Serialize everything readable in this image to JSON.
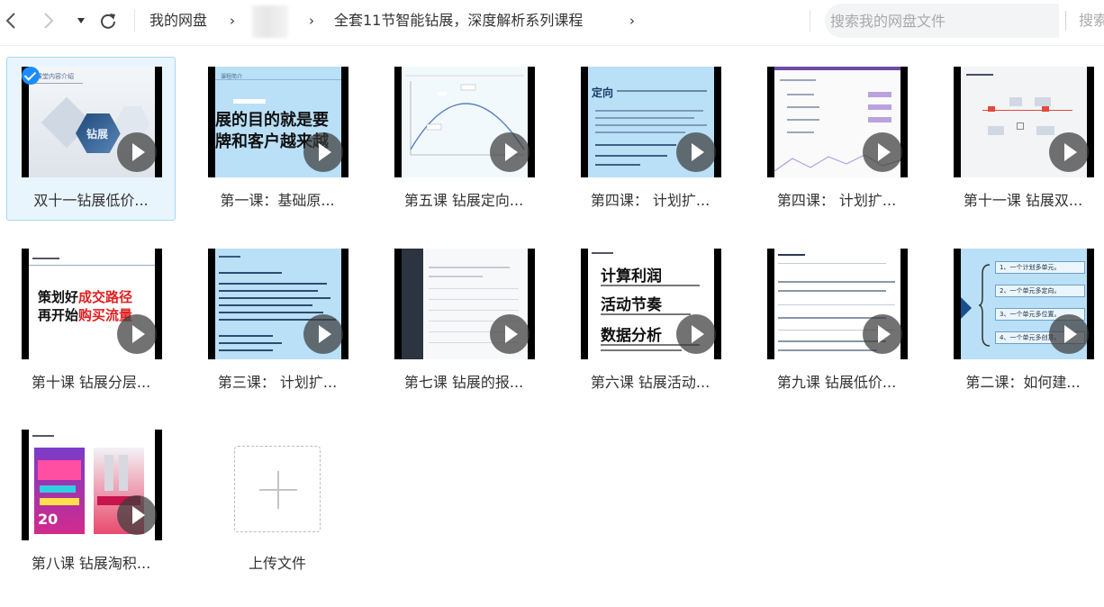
{
  "toolbar": {
    "back_icon": "back-arrow-icon",
    "forward_icon": "forward-arrow-icon",
    "dropdown_icon": "dropdown-triangle-icon",
    "refresh_icon": "refresh-icon",
    "breadcrumb": {
      "root": "我的网盘",
      "current": "全套11节智能钻展，深度解析系列课程"
    },
    "search": {
      "placeholder": "搜索我的网盘文件",
      "button_label": "搜索"
    }
  },
  "files": [
    {
      "name": "双十一钻展低价...",
      "selected": true,
      "thumb_title": "课堂内容介绍",
      "thumb_text": "钻展"
    },
    {
      "name": "第一课：基础原...",
      "selected": false,
      "thumb_title": "课程简介",
      "thumb_text": "展的目的就是要|牌和客户越来越"
    },
    {
      "name": "第五课 钻展定向...",
      "selected": false,
      "thumb_title": "",
      "thumb_text": ""
    },
    {
      "name": "第四课： 计划扩...",
      "selected": false,
      "thumb_title": "定向",
      "thumb_text": ""
    },
    {
      "name": "第四课： 计划扩...",
      "selected": false,
      "thumb_title": "",
      "thumb_text": ""
    },
    {
      "name": "第十一课 钻展双...",
      "selected": false,
      "thumb_title": "",
      "thumb_text": ""
    },
    {
      "name": "第十课  钻展分层...",
      "selected": false,
      "thumb_title": "",
      "thumb_text": "策划好成交路径|再开始购买流量"
    },
    {
      "name": "第三课： 计划扩...",
      "selected": false,
      "thumb_title": "",
      "thumb_text": ""
    },
    {
      "name": "第七课 钻展的报...",
      "selected": false,
      "thumb_title": "",
      "thumb_text": ""
    },
    {
      "name": "第六课 钻展活动...",
      "selected": false,
      "thumb_title": "",
      "thumb_text": "计算利润|活动节奏|数据分析"
    },
    {
      "name": "第九课  钻展低价...",
      "selected": false,
      "thumb_title": "",
      "thumb_text": ""
    },
    {
      "name": "第二课：如何建...",
      "selected": false,
      "thumb_title": "",
      "thumb_text": "1、一个计划多单元。|2、一个单元多定向。|3、一个单元多位置。|4、一个单元多创意。"
    },
    {
      "name": "第八课 钻展淘积...",
      "selected": false,
      "thumb_title": "",
      "thumb_text": "20"
    }
  ],
  "upload": {
    "label": "上传文件",
    "icon": "plus-icon"
  },
  "colors": {
    "selection_bg": "#e9f5fd",
    "selection_border": "#a6d8f6",
    "check": "#1a8cff",
    "thumb_light_blue": "#b9e0f7"
  }
}
